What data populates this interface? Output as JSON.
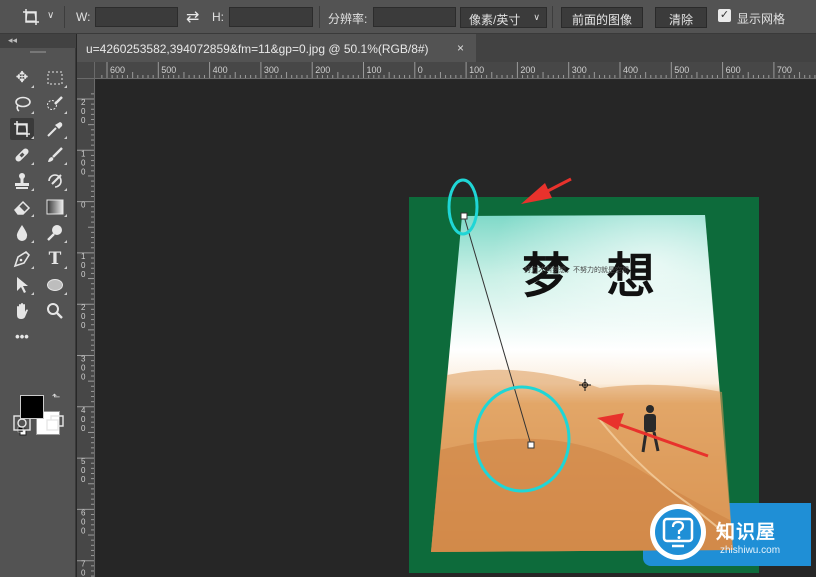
{
  "options_bar": {
    "w_label": "W:",
    "h_label": "H:",
    "resolution_label": "分辨率:",
    "unit_select": "像素/英寸",
    "front_image_button": "前面的图像",
    "clear_button": "清除",
    "show_grid_label": "显示网格",
    "show_grid_checked": true
  },
  "document_tab": {
    "title": "u=4260253582,394072859&fm=11&gp=0.jpg @ 50.1%(RGB/8#)",
    "close": "×"
  },
  "ruler_top": [
    "600",
    "500",
    "400",
    "300",
    "200",
    "100",
    "0",
    "100",
    "200",
    "300",
    "400",
    "500",
    "600",
    "700"
  ],
  "ruler_left": [
    "2 0 0",
    "1 0 0",
    "0",
    "1 0 0",
    "2 0 0",
    "3 0 0",
    "4 0 0",
    "5 0 0",
    "6 0 0",
    "7 0"
  ],
  "poster": {
    "title": "梦 想",
    "subtitle": "努力才叫梦想，不努力的就是空想"
  },
  "watermark": {
    "title": "知识屋",
    "url": "zhishiwu.com"
  },
  "colors": {
    "fg": "#000000",
    "bg": "#ffffff",
    "annotation": "#1fd6d6",
    "arrow": "#e8322c",
    "frame": "#0d6b3b"
  },
  "tools": [
    "move-tool",
    "marquee-tool",
    "lasso-tool",
    "quick-select-tool",
    "crop-tool",
    "eyedropper-tool",
    "healing-tool",
    "brush-tool",
    "stamp-tool",
    "history-brush-tool",
    "eraser-tool",
    "gradient-tool",
    "blur-tool",
    "dodge-tool",
    "pen-tool",
    "type-tool",
    "path-select-tool",
    "shape-tool",
    "hand-tool",
    "zoom-tool",
    "more-tools",
    "quick-mask-tool",
    "screen-mode-tool"
  ]
}
